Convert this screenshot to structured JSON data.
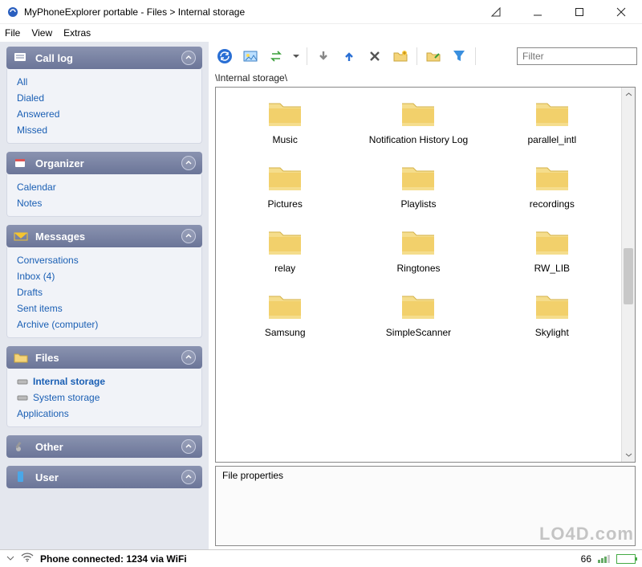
{
  "window": {
    "title": "MyPhoneExplorer portable - Files > Internal storage"
  },
  "menu": {
    "file": "File",
    "view": "View",
    "extras": "Extras"
  },
  "sidebar": {
    "call_log": {
      "title": "Call log",
      "items": [
        "All",
        "Dialed",
        "Answered",
        "Missed"
      ]
    },
    "organizer": {
      "title": "Organizer",
      "items": [
        "Calendar",
        "Notes"
      ]
    },
    "messages": {
      "title": "Messages",
      "items": [
        "Conversations",
        "Inbox (4)",
        "Drafts",
        "Sent items",
        "Archive (computer)"
      ]
    },
    "files": {
      "title": "Files",
      "items": [
        "Internal storage",
        "System storage",
        "Applications"
      ],
      "active_index": 0
    },
    "other": {
      "title": "Other"
    },
    "user": {
      "title": "User"
    }
  },
  "toolbar": {
    "filter_placeholder": "Filter"
  },
  "path": "\\Internal storage\\",
  "folders": [
    "Music",
    "Notification History Log",
    "parallel_intl",
    "Pictures",
    "Playlists",
    "recordings",
    "relay",
    "Ringtones",
    "RW_LIB",
    "Samsung",
    "SimpleScanner",
    "Skylight"
  ],
  "properties": {
    "label": "File properties"
  },
  "status": {
    "text": "Phone connected: 1234 via WiFi",
    "battery": "66"
  },
  "watermark": "LO4D.com"
}
